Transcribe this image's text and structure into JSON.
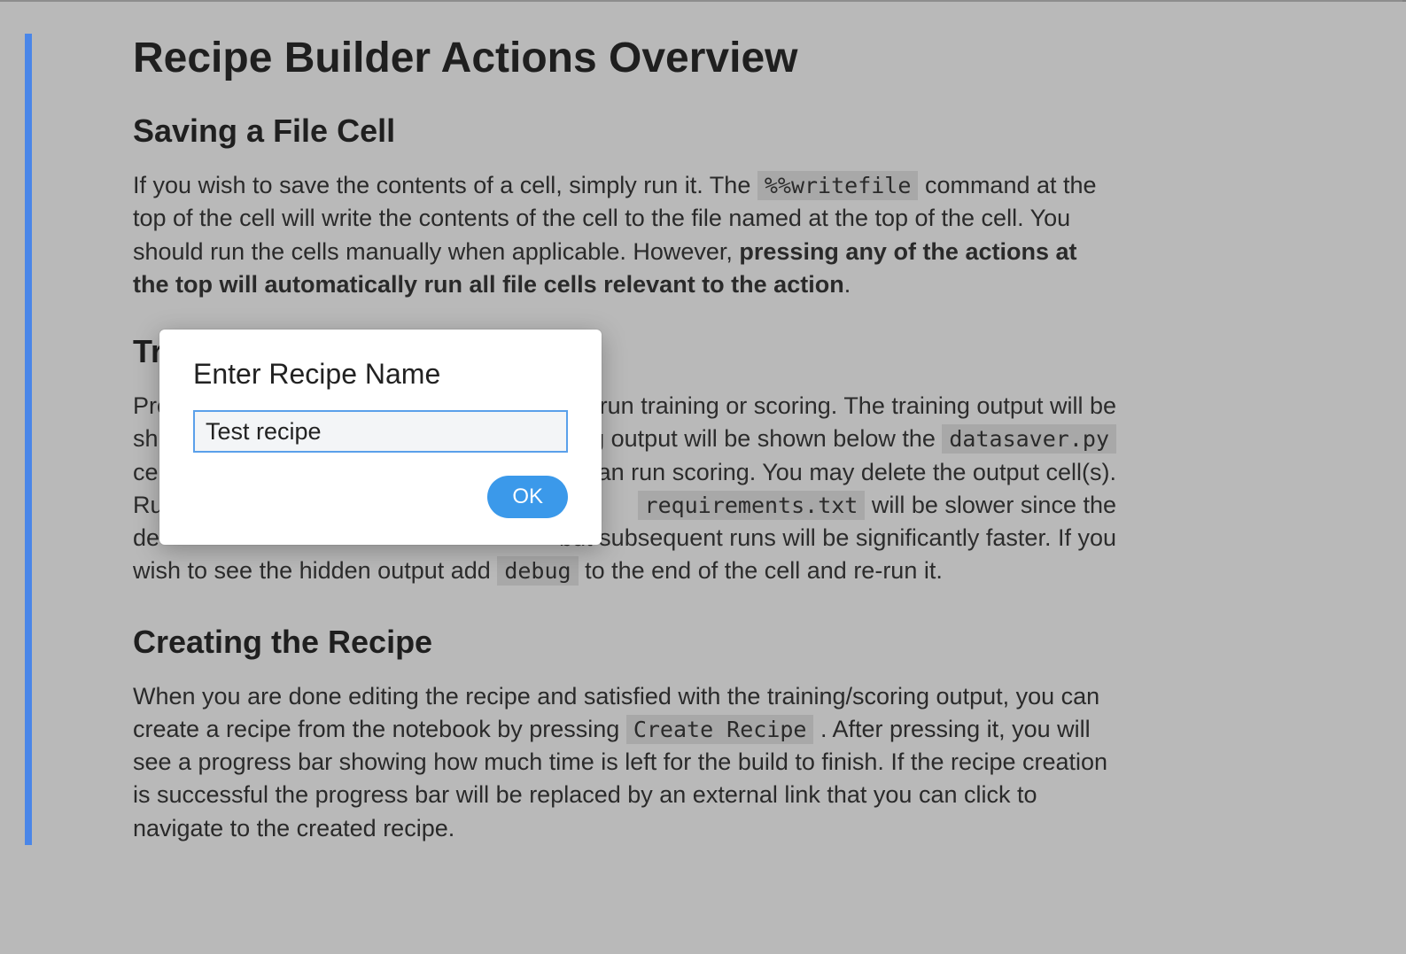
{
  "doc": {
    "title": "Recipe Builder Actions Overview",
    "sections": {
      "saving": {
        "heading": "Saving a File Cell",
        "p1_a": "If you wish to save the contents of a cell, simply run it. The ",
        "code1": "%%writefile",
        "p1_b": " command at the top of the cell will write the contents of the cell to the file named at the top of the cell. You should run the cells manually when applicable. However, ",
        "p1_c_bold": "pressing any of the actions at the top will automatically run all file cells relevant to the action",
        "p1_d": "."
      },
      "train": {
        "heading_visible_prefix": "Tr",
        "p_frag_1_prefix": "Pre",
        "p_frag_1_right": "o run training or scoring. The training output will be",
        "p_frag_2_prefix": "sh",
        "p_frag_2_right_a": "ng output will be shown below the ",
        "p_frag_2_code": "datasaver.py",
        "p_frag_3_prefix": "ce",
        "p_frag_3_right": "u can run scoring. You may delete the output cell(s).",
        "p_frag_4_prefix": "Ru",
        "p_frag_4_code": "requirements.txt",
        "p_frag_4_right": " will be slower since the",
        "p_frag_5_prefix": "de",
        "p_frag_5_right": " but subsequent runs will be significantly faster. If you",
        "p_frag_6_a": "wish to see the hidden output add ",
        "p_frag_6_code": "debug",
        "p_frag_6_b": " to the end of the cell and re-run it."
      },
      "creating": {
        "heading": "Creating the Recipe",
        "p1_a": "When you are done editing the recipe and satisfied with the training/scoring output, you can create a recipe from the notebook by pressing ",
        "code1": "Create Recipe",
        "p1_b": ". After pressing it, you will see a progress bar showing how much time is left for the build to finish. If the recipe creation is successful the progress bar will be replaced by an external link that you can click to navigate to the created recipe."
      }
    }
  },
  "dialog": {
    "title": "Enter Recipe Name",
    "input_value": "Test recipe",
    "ok_label": "OK"
  }
}
